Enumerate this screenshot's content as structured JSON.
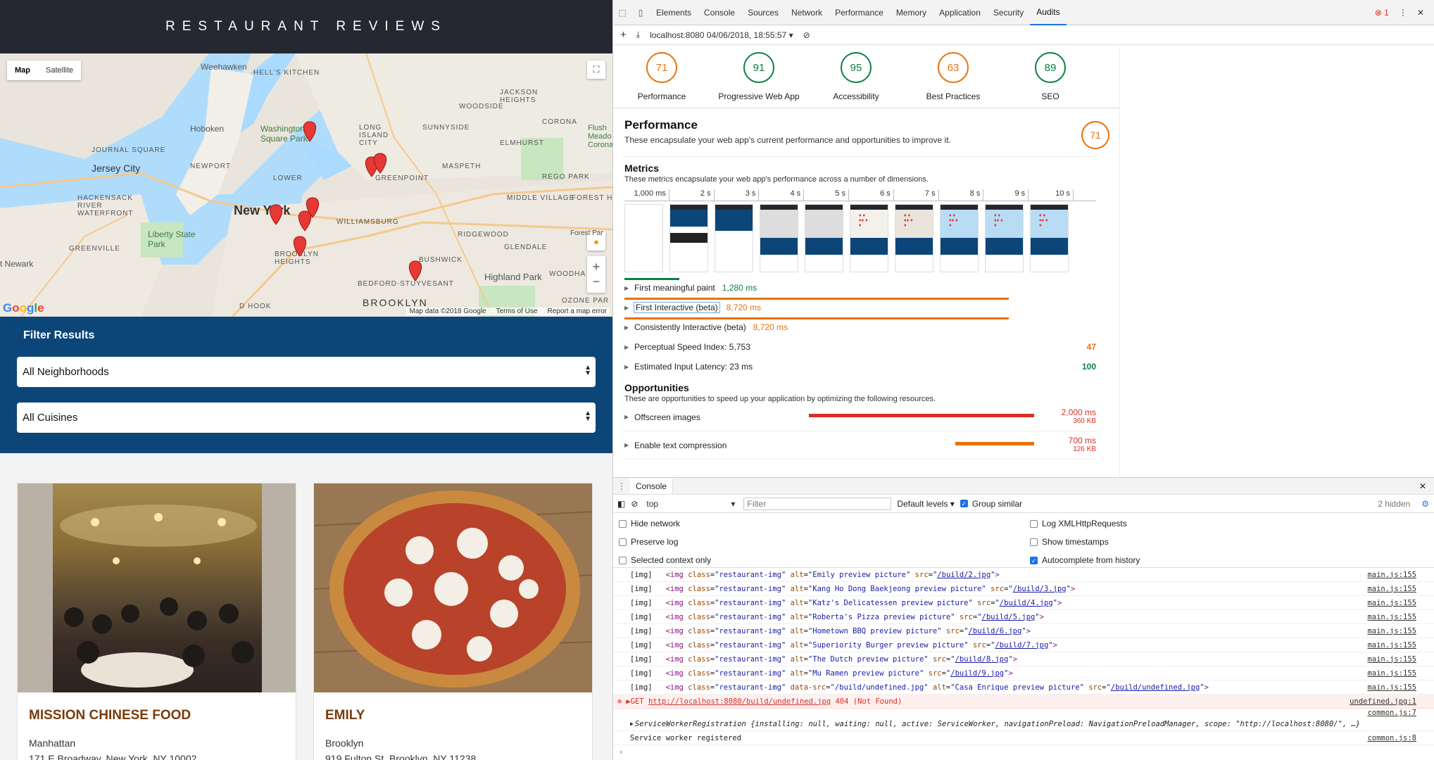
{
  "site": {
    "title": "RESTAURANT REVIEWS",
    "map": {
      "type_options": [
        "Map",
        "Satellite"
      ],
      "active_type": "Map",
      "labels": [
        "Weehawken",
        "HELL'S KITCHEN",
        "Hoboken",
        "Washington Square Park",
        "JOURNAL SQUARE",
        "Jersey City",
        "NEWPORT",
        "New York",
        "HACKENSACK RIVER WATERFRONT",
        "Liberty State Park",
        "GREENVILLE",
        "t Newark",
        "BROOKLYN HEIGHTS",
        "BUSHWICK",
        "Highland Park",
        "BROOKLYN",
        "WILLIAMSBURG",
        "GREENPOINT",
        "MASPETH",
        "ELMHURST",
        "SUNNYSIDE",
        "CORONA",
        "JACKSON HEIGHTS",
        "WOODSIDE",
        "LONG ISLAND CITY",
        "RIDGEWOOD",
        "GLENDALE",
        "MIDDLE VILLAGE",
        "FOREST HI",
        "BEDFORD-STUYVESANT",
        "REGO PARK",
        "Flush Meado Corona",
        "LOWER",
        "D HOOK",
        "OZONE PAR",
        "WOODHA",
        "Forest Par"
      ],
      "attribution": [
        "Map data ©2018 Google",
        "Terms of Use",
        "Report a map error"
      ],
      "google_logo": "Google"
    },
    "filter": {
      "title": "Filter Results",
      "neighborhoods": "All Neighborhoods",
      "cuisines": "All Cuisines"
    },
    "restaurants": [
      {
        "name": "MISSION CHINESE FOOD",
        "neighborhood": "Manhattan",
        "address": "171 E Broadway, New York, NY 10002"
      },
      {
        "name": "EMILY",
        "neighborhood": "Brooklyn",
        "address": "919 Fulton St, Brooklyn, NY 11238"
      }
    ]
  },
  "devtools": {
    "tabs": [
      "Elements",
      "Console",
      "Sources",
      "Network",
      "Performance",
      "Memory",
      "Application",
      "Security",
      "Audits"
    ],
    "active_tab": "Audits",
    "error_count": "1",
    "audit_report": "localhost:8080 04/06/2018, 18:55:57",
    "scores": [
      {
        "value": "71",
        "label": "Performance",
        "status": "orange"
      },
      {
        "value": "91",
        "label": "Progressive Web App",
        "status": "green"
      },
      {
        "value": "95",
        "label": "Accessibility",
        "status": "green"
      },
      {
        "value": "63",
        "label": "Best Practices",
        "status": "orange"
      },
      {
        "value": "89",
        "label": "SEO",
        "status": "green"
      }
    ],
    "performance": {
      "title": "Performance",
      "description": "These encapsulate your web app's current performance and opportunities to improve it.",
      "score": "71",
      "metrics_title": "Metrics",
      "metrics_desc": "These metrics encapsulate your web app's performance across a number of dimensions.",
      "timeline_ticks": [
        "1,000 ms",
        "2 s",
        "3 s",
        "4 s",
        "5 s",
        "6 s",
        "7 s",
        "8 s",
        "9 s",
        "10 s"
      ],
      "metrics": [
        {
          "name": "First meaningful paint",
          "value": "1,280 ms",
          "score": "",
          "color": "green"
        },
        {
          "name": "First Interactive (beta)",
          "value": "8,720 ms",
          "score": "",
          "color": "orange"
        },
        {
          "name": "Consistently Interactive (beta)",
          "value": "8,720 ms",
          "score": "",
          "color": "orange"
        },
        {
          "name": "Perceptual Speed Index: 5,753",
          "value": "",
          "score": "47",
          "color": "orange"
        },
        {
          "name": "Estimated Input Latency: 23 ms",
          "value": "",
          "score": "100",
          "color": "green"
        }
      ],
      "opportunities_title": "Opportunities",
      "opportunities_desc": "These are opportunities to speed up your application by optimizing the following resources.",
      "opportunities": [
        {
          "name": "Offscreen images",
          "time": "2,000 ms",
          "size": "360 KB",
          "color": "red"
        },
        {
          "name": "Enable text compression",
          "time": "700 ms",
          "size": "126 KB",
          "color": "orange"
        }
      ]
    },
    "console": {
      "drawer_tab": "Console",
      "context": "top",
      "filter_placeholder": "Filter",
      "levels": "Default levels",
      "group_similar": "Group similar",
      "hidden": "2 hidden",
      "settings_left": [
        "Hide network",
        "Preserve log",
        "Selected context only"
      ],
      "settings_right": [
        "Log XMLHttpRequests",
        "Show timestamps",
        "Autocomplete from history"
      ],
      "img_logs": [
        {
          "alt": "Emily preview picture",
          "src": "/build/2.jpg",
          "source": "main.js:155"
        },
        {
          "alt": "Kang Ho Dong Baekjeong preview picture",
          "src": "/build/3.jpg",
          "source": "main.js:155"
        },
        {
          "alt": "Katz's Delicatessen preview picture",
          "src": "/build/4.jpg",
          "source": "main.js:155"
        },
        {
          "alt": "Roberta's Pizza preview picture",
          "src": "/build/5.jpg",
          "source": "main.js:155"
        },
        {
          "alt": "Hometown BBQ preview picture",
          "src": "/build/6.jpg",
          "source": "main.js:155"
        },
        {
          "alt": "Superiority Burger preview picture",
          "src": "/build/7.jpg",
          "source": "main.js:155"
        },
        {
          "alt": "The Dutch preview picture",
          "src": "/build/8.jpg",
          "source": "main.js:155"
        },
        {
          "alt": "Mu Ramen preview picture",
          "src": "/build/9.jpg",
          "source": "main.js:155"
        }
      ],
      "last_img": {
        "datasrc": "/build/undefined.jpg",
        "alt": "Casa Enrique preview picture",
        "src": "/build/undefined.jpg",
        "source": "main.js:155"
      },
      "error_line": {
        "text": "GET",
        "url": "http://localhost:8080/build/undefined.jpg",
        "status": "404 (Not Found)",
        "source": "undefined.jpg:1"
      },
      "sw_source_1": "common.js:7",
      "sw_line": "ServiceWorkerRegistration {installing: null, waiting: null, active: ServiceWorker, navigationPreload: NavigationPreloadManager, scope: \"http://localhost:8080/\", …}",
      "registered_line": "Service worker registered",
      "registered_source": "common.js:8"
    }
  }
}
